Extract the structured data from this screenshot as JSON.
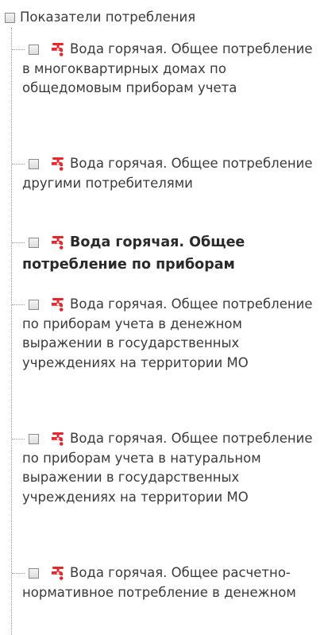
{
  "tree": {
    "root_label": "Показатели потребления",
    "items": [
      {
        "label": "Вода горячая. Общее потребление в многоквартирных домах по общедомовым приборам учета",
        "bold": false
      },
      {
        "label": "Вода горячая. Общее потребление другими потребителями",
        "bold": false
      },
      {
        "label": "Вода горячая. Общее потребление по приборам",
        "bold": true
      },
      {
        "label": "Вода горячая. Общее потребление по приборам учета в денежном выражении в государственных учреждениях на территории МО",
        "bold": false
      },
      {
        "label": "Вода горячая. Общее потребление по приборам учета в натуральном выражении в государственных учреждениях на территории МО",
        "bold": false
      },
      {
        "label": "Вода горячая. Общее расчетно-нормативное потребление в денежном",
        "bold": false
      }
    ]
  },
  "icons": {
    "item_icon": "hot-water-tap-icon",
    "tap_color": "#e8262b"
  }
}
